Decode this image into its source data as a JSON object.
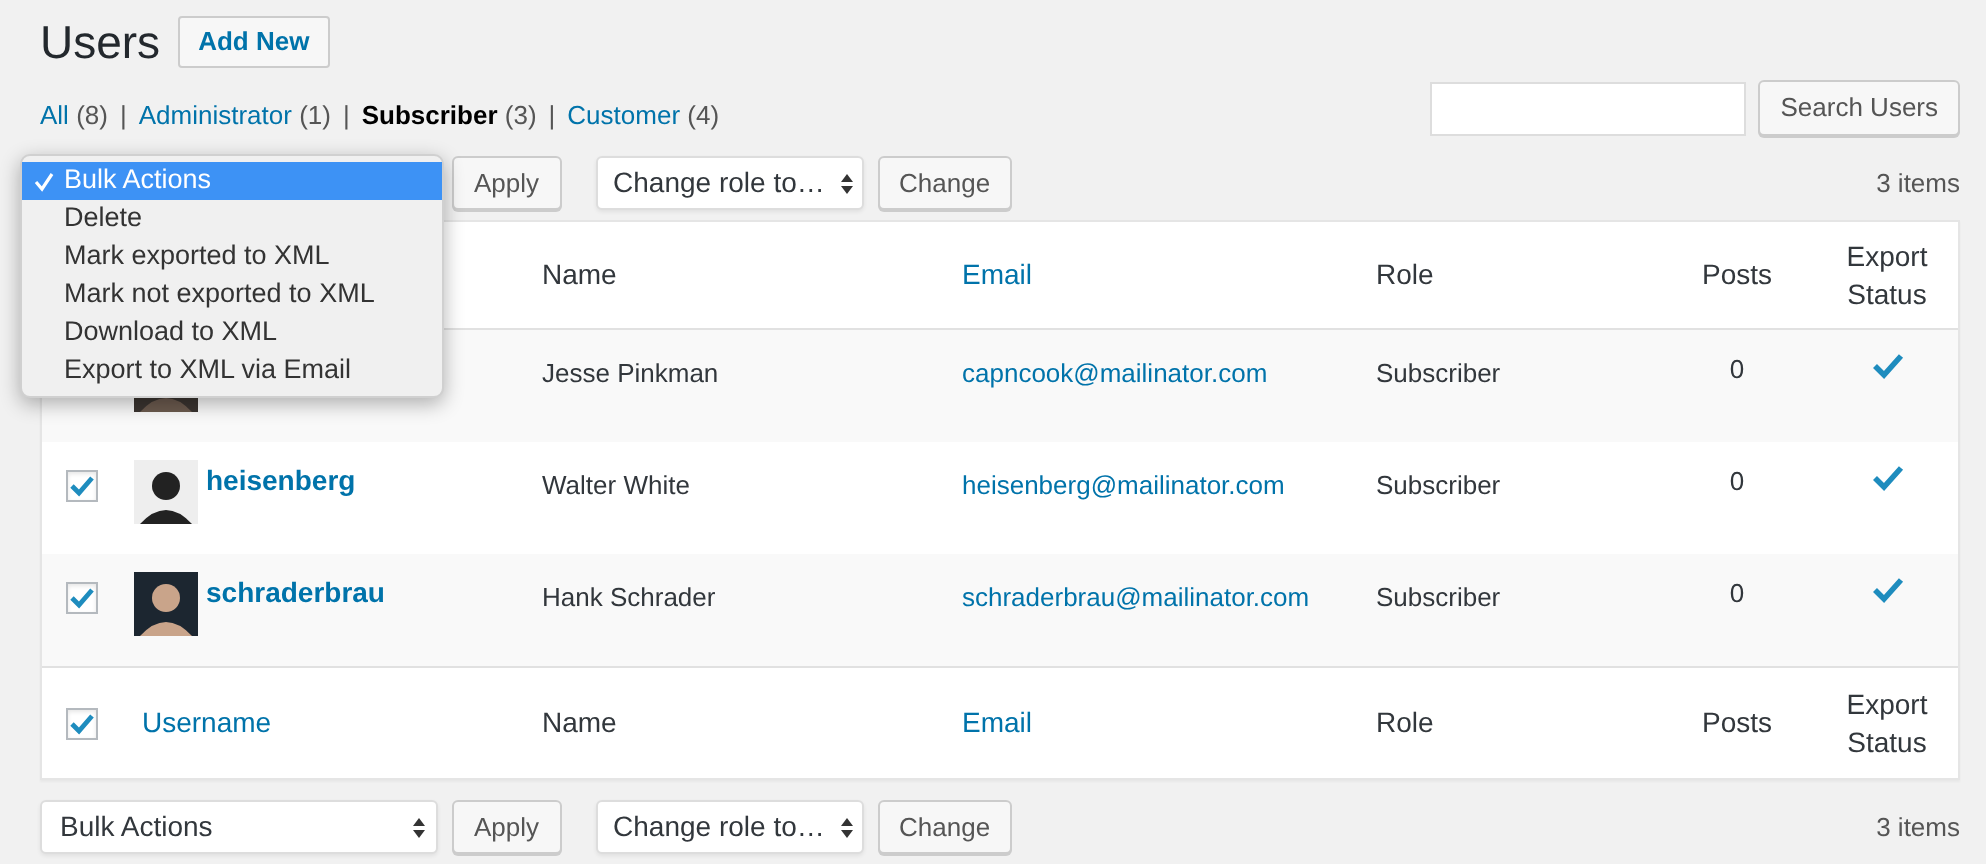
{
  "page": {
    "title": "Users",
    "add_button": "Add New"
  },
  "filters": [
    {
      "label": "All",
      "count": "(8)",
      "selected": false
    },
    {
      "separator": "|",
      "label": "Administrator",
      "count": "(1)",
      "selected": false
    },
    {
      "separator": "|",
      "label": "Subscriber",
      "count": "(3)",
      "selected": true
    },
    {
      "separator": "|",
      "label": "Customer",
      "count": "(4)",
      "selected": false
    }
  ],
  "search": {
    "button": "Search Users"
  },
  "top_toolbar": {
    "apply": "Apply",
    "role_select": "Change role to…",
    "change": "Change",
    "count": "3 items"
  },
  "bulk_menu": [
    {
      "label": "Bulk Actions",
      "selected": true
    },
    {
      "label": "Delete",
      "selected": false
    },
    {
      "label": "Mark exported to XML",
      "selected": false
    },
    {
      "label": "Mark not exported to XML",
      "selected": false
    },
    {
      "label": "Download to XML",
      "selected": false
    },
    {
      "label": "Export to XML via Email",
      "selected": false
    }
  ],
  "table": {
    "header_columns": [
      {
        "label": "Name",
        "sortable": false
      },
      {
        "label": "Email",
        "sortable": true
      },
      {
        "label": "Role",
        "sortable": false
      },
      {
        "label": "Posts",
        "sortable": false
      },
      {
        "label": "Export Status",
        "sortable": false
      }
    ],
    "rows": [
      {
        "name": "Jesse Pinkman",
        "email": "capncook@mailinator.com",
        "role": "Subscriber",
        "posts": "0",
        "exported": true
      },
      {
        "checked": true,
        "username": "heisenberg",
        "name": "Walter White",
        "email": "heisenberg@mailinator.com",
        "role": "Subscriber",
        "posts": "0",
        "exported": true
      },
      {
        "checked": true,
        "username": "schraderbrau",
        "name": "Hank Schrader",
        "email": "schraderbrau@mailinator.com",
        "role": "Subscriber",
        "posts": "0",
        "exported": true
      }
    ],
    "footer_checked": true,
    "footer_columns": [
      {
        "label": "Username",
        "sortable": true
      },
      {
        "label": "Name",
        "sortable": false
      },
      {
        "label": "Email",
        "sortable": true
      },
      {
        "label": "Role",
        "sortable": false
      },
      {
        "label": "Posts",
        "sortable": false
      },
      {
        "label": "Export Status",
        "sortable": false
      }
    ]
  },
  "bottom_toolbar": {
    "bulk_select": "Bulk Actions",
    "apply": "Apply",
    "role_select": "Change role to…",
    "change": "Change",
    "count": "3 items"
  }
}
